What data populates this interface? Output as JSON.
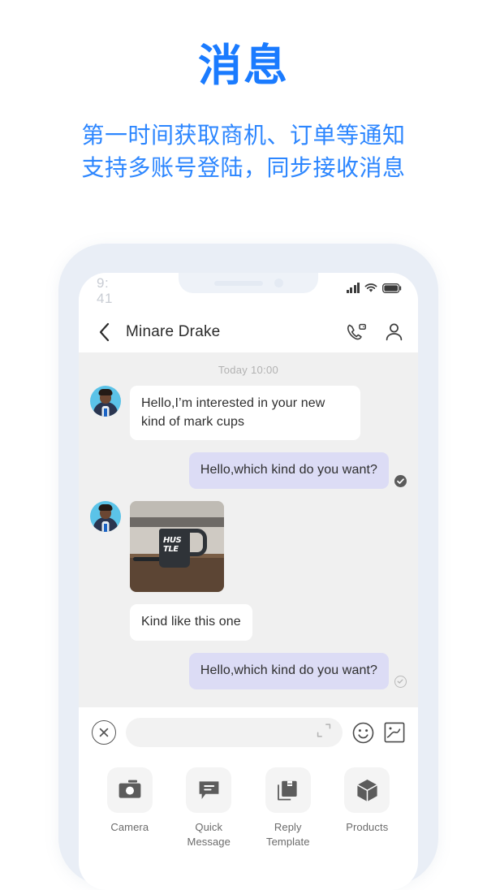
{
  "promo": {
    "title": "消息",
    "subtitle_lines": [
      "第一时间获取商机、订单等通知",
      "支持多账号登陆，同步接收消息"
    ],
    "title_color": "#1A7BFF",
    "subtitle_color": "#2C86FF"
  },
  "phone": {
    "status_bar": {
      "time_top": "9:",
      "time_bottom": "41",
      "icons": [
        "signal-bars-icon",
        "wifi-icon",
        "battery-icon"
      ]
    },
    "nav": {
      "back_icon": "chevron-left-icon",
      "title": "Minare Drake",
      "video_call_icon": "video-call-icon",
      "contact_icon": "contact-person-icon"
    },
    "chat": {
      "date_divider": "Today 10:00",
      "bubble_in_color": "#FFFFFF",
      "bubble_out_color": "#DCDCF5",
      "background_color": "#F0F0F0",
      "messages": [
        {
          "id": "m1",
          "direction": "in",
          "type": "text",
          "text": "Hello,I’m interested in your new kind of mark cups",
          "avatar": true
        },
        {
          "id": "m2",
          "direction": "out",
          "type": "text",
          "text": "Hello,which kind do you want?",
          "status": "sent"
        },
        {
          "id": "m3",
          "direction": "in",
          "type": "image",
          "image_alt": "dark-hustle-mug-photo",
          "image_caption_words": [
            "HUS",
            "TLE"
          ],
          "avatar": true
        },
        {
          "id": "m4",
          "direction": "in",
          "type": "text",
          "text": "Kind like this one",
          "avatar": false
        },
        {
          "id": "m5",
          "direction": "out",
          "type": "text",
          "text": "Hello,which kind do you want?",
          "status": "read"
        }
      ]
    },
    "input_bar": {
      "close_icon": "close-circle-icon",
      "placeholder": "",
      "value": "",
      "expand_icon": "expand-fullscreen-icon",
      "emoji_icon": "emoji-smiley-icon",
      "image_icon": "image-picture-icon"
    },
    "actions": [
      {
        "label": "Camera",
        "icon": "camera-icon"
      },
      {
        "label": "Quick\nMessage",
        "label_line1": "Quick",
        "label_line2": "Message",
        "icon": "chat-bubble-icon"
      },
      {
        "label": "Reply\nTemplate",
        "label_line1": "Reply",
        "label_line2": "Template",
        "icon": "book-template-icon"
      },
      {
        "label": "Products",
        "label_line1": "Products",
        "label_line2": "",
        "icon": "box-cube-icon"
      }
    ]
  }
}
